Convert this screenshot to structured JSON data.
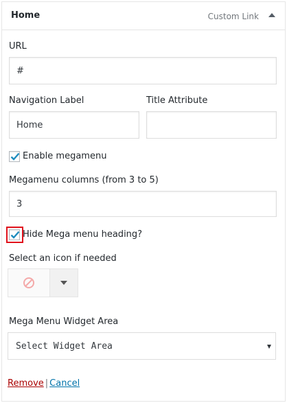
{
  "header": {
    "title": "Home",
    "type": "Custom Link"
  },
  "url": {
    "label": "URL",
    "value": "#"
  },
  "navigation_label": {
    "label": "Navigation Label",
    "value": "Home"
  },
  "title_attribute": {
    "label": "Title Attribute",
    "value": ""
  },
  "enable_megamenu": {
    "label": "Enable megamenu",
    "checked": true
  },
  "megamenu_columns": {
    "label": "Megamenu columns (from 3 to 5)",
    "value": "3"
  },
  "hide_heading": {
    "label": "Hide Mega menu heading?",
    "checked": true
  },
  "icon": {
    "label": "Select an icon if needed",
    "icon_name": "ban-icon"
  },
  "widget_area": {
    "label": "Mega Menu Widget Area",
    "selected": "Select Widget Area"
  },
  "actions": {
    "remove": "Remove",
    "separator": "|",
    "cancel": "Cancel"
  },
  "colors": {
    "checkmark": "#1e8cbe",
    "highlight": "#e0111b",
    "remove_link": "#aa0000",
    "cancel_link": "#0073aa",
    "ban_icon": "#f4a9a9"
  }
}
